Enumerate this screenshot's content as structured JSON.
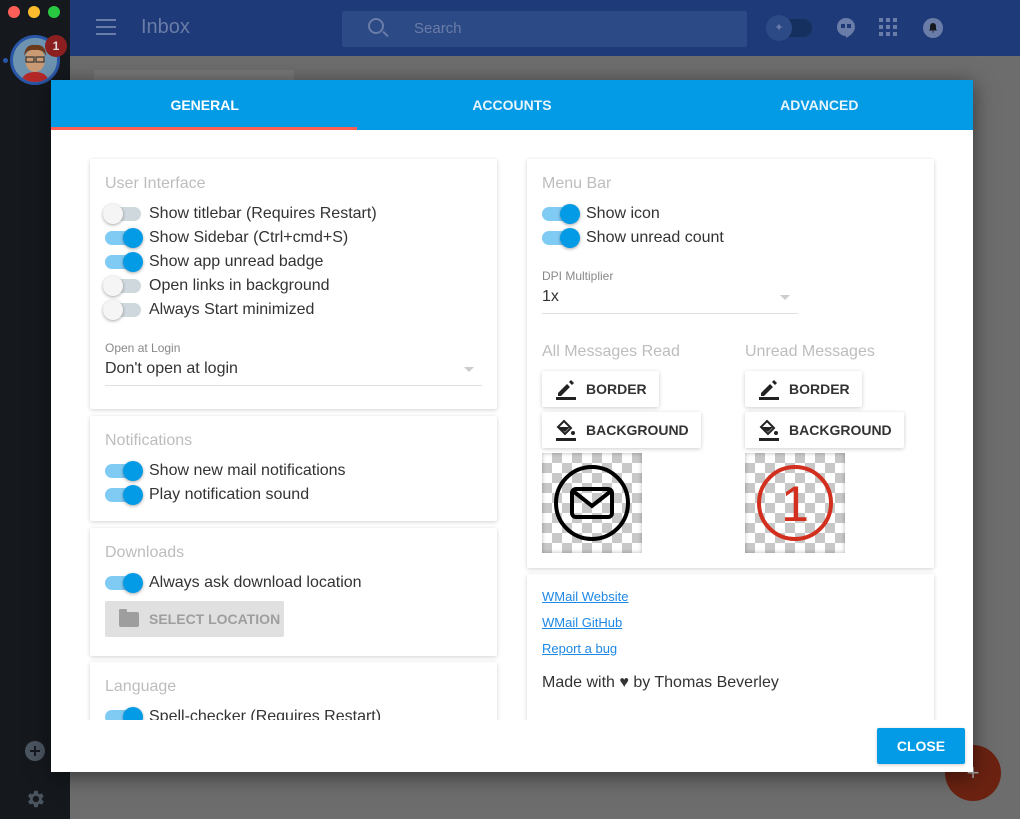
{
  "window": {
    "controls": [
      "close",
      "minimize",
      "zoom"
    ]
  },
  "sidebar": {
    "account_badge": "1",
    "add_icon": "plus-circle-icon",
    "settings_icon": "gear-icon"
  },
  "appbar": {
    "title": "Inbox",
    "search_placeholder": "Search",
    "icons": [
      "pin-toggle",
      "hangouts-icon",
      "apps-grid-icon",
      "notifications-icon"
    ]
  },
  "dialog": {
    "tabs": [
      {
        "label": "GENERAL",
        "active": true
      },
      {
        "label": "ACCOUNTS",
        "active": false
      },
      {
        "label": "ADVANCED",
        "active": false
      }
    ],
    "user_interface": {
      "title": "User Interface",
      "toggles": [
        {
          "label": "Show titlebar (Requires Restart)",
          "on": false
        },
        {
          "label": "Show Sidebar (Ctrl+cmd+S)",
          "on": true
        },
        {
          "label": "Show app unread badge",
          "on": true
        },
        {
          "label": "Open links in background",
          "on": false
        },
        {
          "label": "Always Start minimized",
          "on": false
        }
      ],
      "open_at_login_label": "Open at Login",
      "open_at_login_value": "Don't open at login"
    },
    "notifications": {
      "title": "Notifications",
      "toggles": [
        {
          "label": "Show new mail notifications",
          "on": true
        },
        {
          "label": "Play notification sound",
          "on": true
        }
      ]
    },
    "downloads": {
      "title": "Downloads",
      "toggles": [
        {
          "label": "Always ask download location",
          "on": true
        }
      ],
      "select_location": "SELECT LOCATION"
    },
    "language": {
      "title": "Language",
      "toggles": [
        {
          "label": "Spell-checker (Requires Restart)",
          "on": true
        }
      ]
    },
    "menu_bar": {
      "title": "Menu Bar",
      "toggles": [
        {
          "label": "Show icon",
          "on": true
        },
        {
          "label": "Show unread count",
          "on": true
        }
      ],
      "dpi_label": "DPI Multiplier",
      "dpi_value": "1x",
      "read": {
        "title": "All Messages Read",
        "border": "BORDER",
        "background": "BACKGROUND"
      },
      "unread": {
        "title": "Unread Messages",
        "border": "BORDER",
        "background": "BACKGROUND",
        "count": "1",
        "color": "#d32f1e"
      }
    },
    "about": {
      "links": [
        "WMail Website",
        "WMail GitHub",
        "Report a bug"
      ],
      "credit": "Made with ♥ by Thomas Beverley"
    },
    "close": "CLOSE"
  },
  "colors": {
    "accent": "#039be5",
    "tab_ink": "#ff5f52",
    "appbar": "#1e3a78"
  }
}
